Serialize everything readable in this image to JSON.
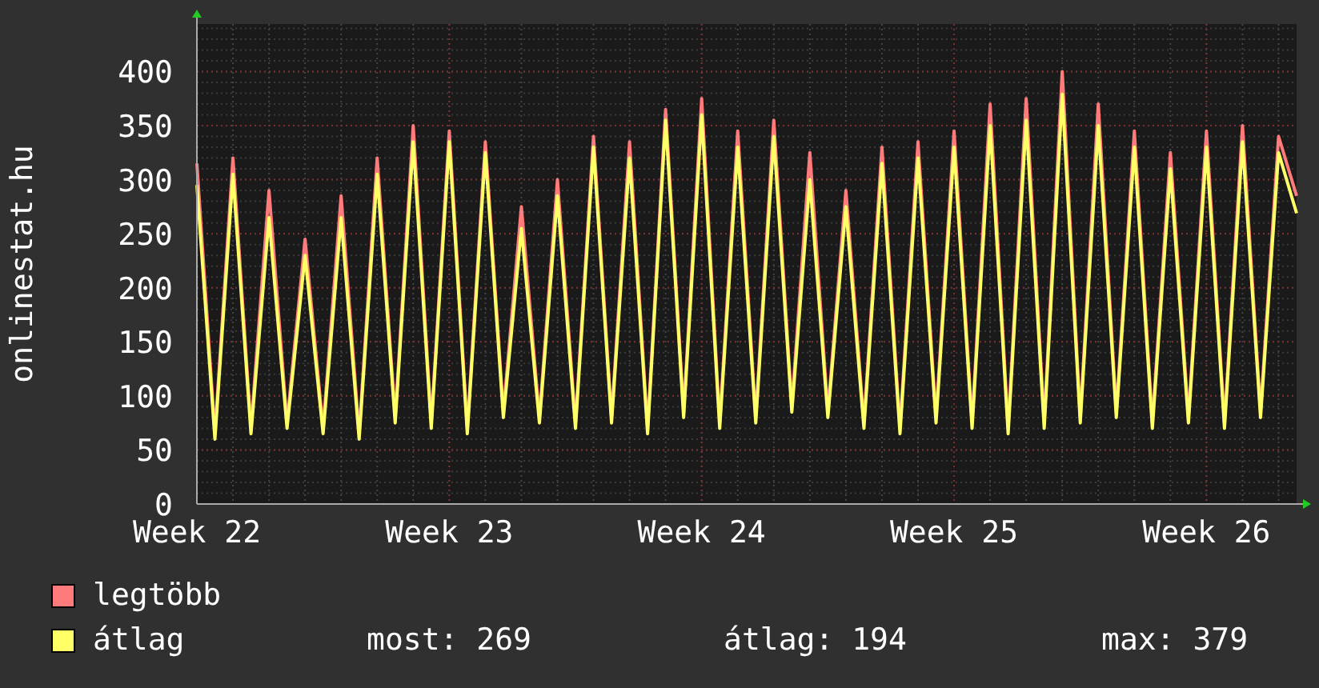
{
  "chart": {
    "chart_data": {
      "type": "line",
      "grid": true,
      "ylabel": "onlinestat.hu",
      "ylim": [
        0,
        444
      ],
      "yticks": [
        0,
        50,
        100,
        150,
        200,
        250,
        300,
        350,
        400
      ],
      "categories": [
        "Week 22",
        null,
        null,
        null,
        null,
        null,
        null,
        null,
        null,
        null,
        null,
        null,
        null,
        null,
        "Week 23",
        null,
        null,
        null,
        null,
        null,
        null,
        null,
        null,
        null,
        null,
        null,
        null,
        null,
        "Week 24",
        null,
        null,
        null,
        null,
        null,
        null,
        null,
        null,
        null,
        null,
        null,
        null,
        null,
        "Week 25",
        null,
        null,
        null,
        null,
        null,
        null,
        null,
        null,
        null,
        null,
        null,
        null,
        null,
        "Week 26",
        null,
        null,
        null,
        null,
        null
      ],
      "series": [
        {
          "name": "legtöbb",
          "color": "#ff7b7b",
          "values": [
            315,
            65,
            320,
            70,
            290,
            75,
            245,
            70,
            285,
            65,
            320,
            80,
            350,
            75,
            345,
            70,
            335,
            85,
            275,
            80,
            300,
            75,
            340,
            80,
            335,
            70,
            365,
            85,
            375,
            75,
            345,
            80,
            355,
            90,
            325,
            85,
            290,
            75,
            330,
            70,
            335,
            80,
            345,
            75,
            370,
            70,
            375,
            75,
            400,
            80,
            370,
            85,
            345,
            75,
            325,
            80,
            345,
            75,
            350,
            85,
            340,
            285
          ]
        },
        {
          "name": "átlag",
          "color": "#ffff66",
          "values": [
            295,
            60,
            305,
            65,
            265,
            70,
            230,
            65,
            265,
            60,
            305,
            75,
            335,
            70,
            335,
            65,
            325,
            80,
            255,
            75,
            285,
            70,
            330,
            75,
            320,
            65,
            355,
            80,
            360,
            70,
            330,
            75,
            340,
            85,
            300,
            80,
            275,
            70,
            315,
            65,
            320,
            75,
            330,
            70,
            350,
            65,
            355,
            70,
            379,
            75,
            350,
            80,
            330,
            70,
            310,
            75,
            330,
            70,
            335,
            80,
            325,
            269
          ]
        }
      ]
    }
  },
  "legend": {
    "stats": [
      "most: 269",
      "átlag: 194",
      "max: 379"
    ]
  }
}
